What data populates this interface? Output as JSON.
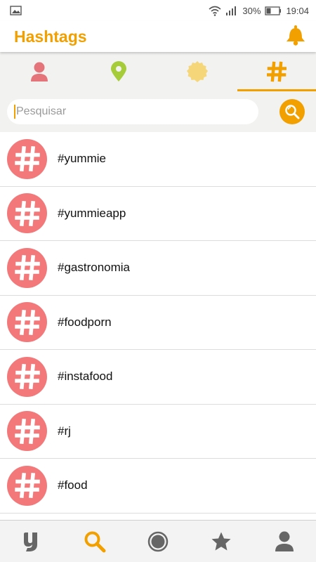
{
  "status_bar": {
    "battery": "30%",
    "time": "19:04"
  },
  "header": {
    "title": "Hashtags"
  },
  "tabs": [
    {
      "icon": "person-icon",
      "active": false
    },
    {
      "icon": "location-pin-icon",
      "active": false
    },
    {
      "icon": "badge-icon",
      "active": false
    },
    {
      "icon": "hashtag-icon",
      "active": true
    }
  ],
  "search": {
    "placeholder": "Pesquisar",
    "value": ""
  },
  "hashtags": [
    {
      "label": "#yummie"
    },
    {
      "label": "#yummieapp"
    },
    {
      "label": "#gastronomia"
    },
    {
      "label": "#foodporn"
    },
    {
      "label": "#instafood"
    },
    {
      "label": "#rj"
    },
    {
      "label": "#food"
    }
  ],
  "bottom_nav": [
    {
      "icon": "yummie-logo-icon",
      "active": false
    },
    {
      "icon": "search-icon",
      "active": true
    },
    {
      "icon": "record-icon",
      "active": false
    },
    {
      "icon": "star-icon",
      "active": false
    },
    {
      "icon": "profile-icon",
      "active": false
    }
  ],
  "colors": {
    "accent": "#f2a000",
    "hashtag_avatar": "#f2787a",
    "tab_bar_bg": "#f2f2f1",
    "nav_inactive": "#666666"
  }
}
